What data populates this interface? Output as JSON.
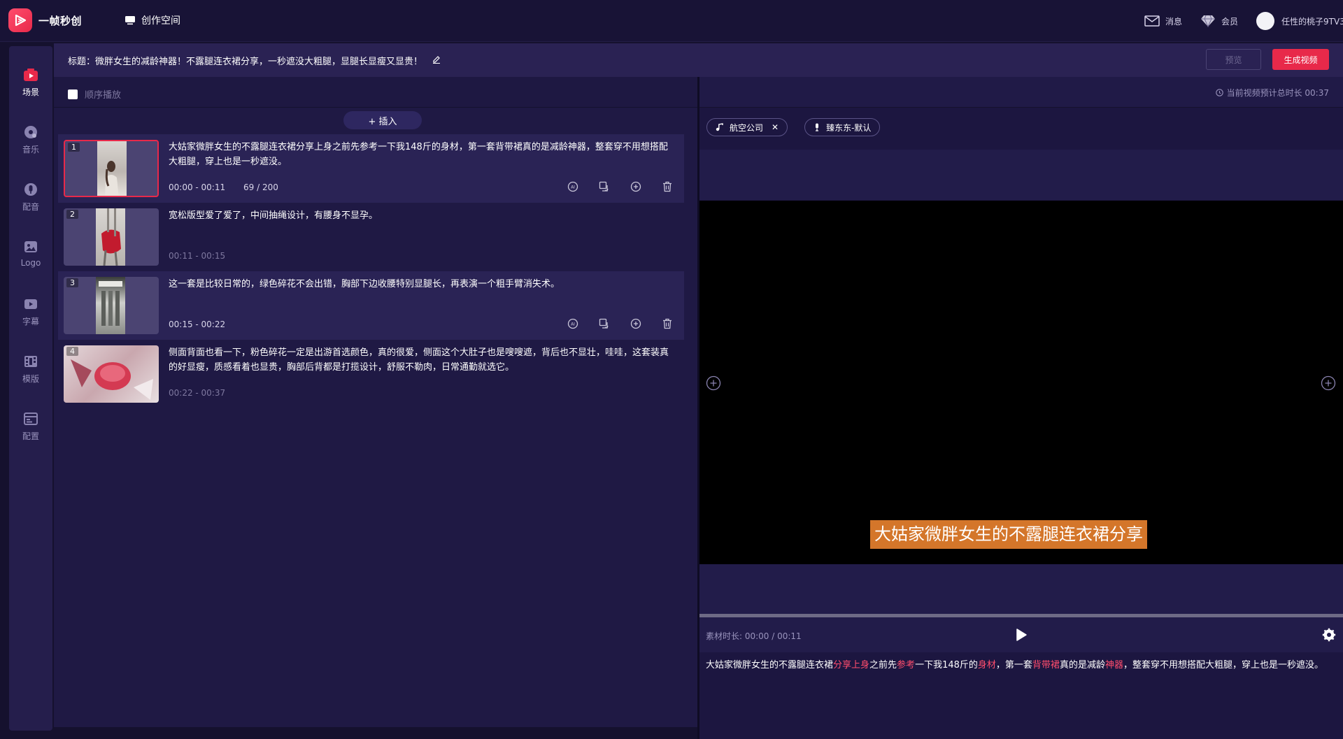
{
  "app": {
    "name": "一帧秒创",
    "workspace": "创作空间"
  },
  "topbar": {
    "messages": "消息",
    "member": "会员",
    "username": "任性的桃子9TV3"
  },
  "sidebar": {
    "items": [
      {
        "label": "场景",
        "icon": "scene-icon",
        "active": true
      },
      {
        "label": "音乐",
        "icon": "music-icon",
        "active": false
      },
      {
        "label": "配音",
        "icon": "voice-icon",
        "active": false
      },
      {
        "label": "Logo",
        "icon": "logo-icon",
        "active": false
      },
      {
        "label": "字幕",
        "icon": "subtitle-icon",
        "active": false
      },
      {
        "label": "模版",
        "icon": "template-icon",
        "active": false
      },
      {
        "label": "配置",
        "icon": "config-icon",
        "active": false
      }
    ]
  },
  "header": {
    "title": "标题：微胖女生的减龄神器！不露腿连衣裙分享，一秒遮没大粗腿，显腿长显瘦又显贵！",
    "preview_label": "预览",
    "generate_label": "生成视频"
  },
  "left": {
    "sequential_play": "顺序播放",
    "insert_label": "+ 插入",
    "scenes": [
      {
        "num": "1",
        "text": "大姑家微胖女生的不露腿连衣裙分享上身之前先参考一下我148斤的身材，第一套背带裙真的是减龄神器，整套穿不用想搭配大粗腿，穿上也是一秒遮没。",
        "time": "00:00 - 00:11",
        "count": "69 / 200"
      },
      {
        "num": "2",
        "text": "宽松版型爱了爱了，中间抽绳设计，有腰身不显孕。",
        "time": "00:11 - 00:15",
        "count": ""
      },
      {
        "num": "3",
        "text": "这一套是比较日常的，绿色碎花不会出错，胸部下边收腰特别显腿长，再表演一个粗手臂消失术。",
        "time": "00:15 - 00:22",
        "count": ""
      },
      {
        "num": "4",
        "text": "侧面背面也看一下，粉色碎花一定是出游首选颜色，真的很爱，侧面这个大肚子也是嗖嗖遮，背后也不显壮，哇哇，这套装真的好显瘦，质感看着也显贵，胸部后背都是打揽设计，舒服不勒肉，日常通勤就选它。",
        "time": "00:22 - 00:37",
        "count": ""
      }
    ]
  },
  "right": {
    "duration": "当前视频预计总时长 00:37",
    "chips": [
      {
        "label": "航空公司",
        "icon": "music-note-icon"
      },
      {
        "label": "臻东东-默认",
        "icon": "mic-icon"
      }
    ],
    "caption": "大姑家微胖女生的不露腿连衣裙分享",
    "material_time": "素材时长: 00:00 / 00:11",
    "script_segments": [
      {
        "text": "大姑家微胖女生的不露腿连衣裙",
        "kw": false
      },
      {
        "text": "分享上身",
        "kw": true
      },
      {
        "text": "之前先",
        "kw": false
      },
      {
        "text": "参考",
        "kw": true
      },
      {
        "text": "一下我148斤的",
        "kw": false
      },
      {
        "text": "身材",
        "kw": true
      },
      {
        "text": "，第一套",
        "kw": false
      },
      {
        "text": "背带裙",
        "kw": true
      },
      {
        "text": "真的是减龄",
        "kw": false
      },
      {
        "text": "神器",
        "kw": true
      },
      {
        "text": "，整套穿不用想搭配大粗腿，穿上也是一秒遮没。",
        "kw": false
      }
    ]
  },
  "colors": {
    "accent": "#e8294a",
    "caption_bg": "#d4762a",
    "panel": "#1f1944"
  }
}
